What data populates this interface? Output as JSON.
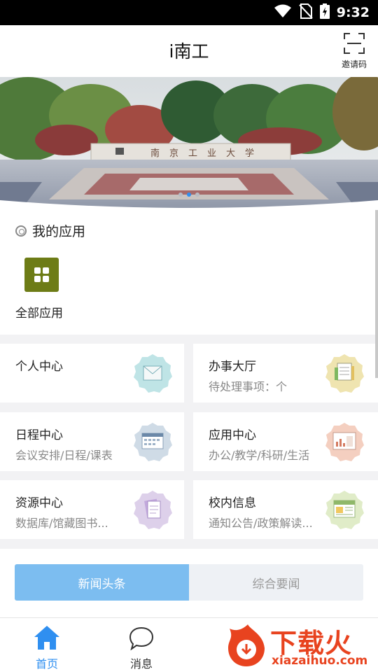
{
  "status_bar": {
    "time": "9:32"
  },
  "header": {
    "title": "i南工",
    "invite_label": "邀请码"
  },
  "banner": {
    "slides": 3,
    "active_slide": 1
  },
  "my_apps": {
    "title": "我的应用",
    "all_apps_label": "全部应用"
  },
  "cards": [
    {
      "title": "个人中心",
      "subtitle": ""
    },
    {
      "title": "办事大厅",
      "subtitle": "待处理事项：个"
    },
    {
      "title": "日程中心",
      "subtitle": "会议安排/日程/课表"
    },
    {
      "title": "应用中心",
      "subtitle": "办公/教学/科研/生活"
    },
    {
      "title": "资源中心",
      "subtitle": "数据库/馆藏图书..."
    },
    {
      "title": "校内信息",
      "subtitle": "通知公告/政策解读..."
    }
  ],
  "news_tabs": [
    {
      "label": "新闻头条",
      "active": true
    },
    {
      "label": "综合要闻",
      "active": false
    }
  ],
  "bottom_nav": [
    {
      "label": "首页",
      "active": true
    },
    {
      "label": "消息",
      "active": false
    }
  ],
  "watermark": {
    "text": "下载火",
    "url": "xiazaihuo.com"
  },
  "colors": {
    "accent": "#2f8ff0",
    "tile": "#6d7c16",
    "tab_active": "#7cbdf0",
    "watermark": "#e8431f"
  }
}
